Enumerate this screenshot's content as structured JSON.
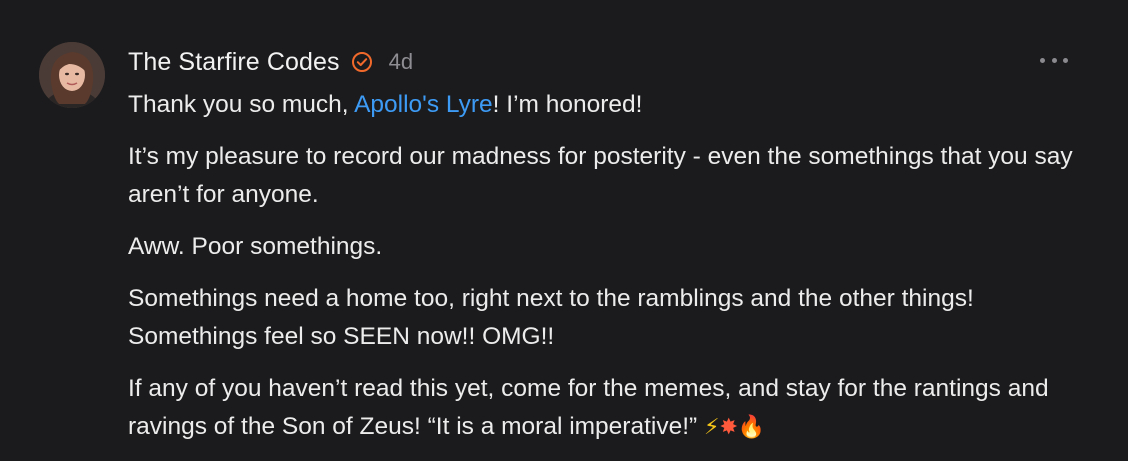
{
  "comment": {
    "author": "The Starfire Codes",
    "timestamp": "4d",
    "verified_icon": "verified-check-icon",
    "more_icon": "more-options-icon",
    "paragraphs": {
      "p1": {
        "before": "Thank you so much, ",
        "mention": "Apollo's Lyre",
        "after": "! I’m honored!"
      },
      "p2": "It’s my pleasure to record our madness for posterity - even the somethings that you say aren’t for anyone.",
      "p3": "Aww. Poor somethings.",
      "p4": "Somethings need a home too, right next to the ramblings and the other things! Somethings feel so SEEN now!! OMG!!",
      "p5": {
        "text": "If any of you haven’t read this yet, come for the memes, and stay for the rantings and ravings of the Son of Zeus! “It is a moral imperative!” ",
        "emojis": [
          "⚡",
          "✸",
          "🔥"
        ]
      }
    }
  },
  "colors": {
    "background": "#1b1b1d",
    "text": "#ececec",
    "muted": "#8d8d92",
    "mention": "#3d9bf5",
    "verified": "#f26a2b"
  }
}
